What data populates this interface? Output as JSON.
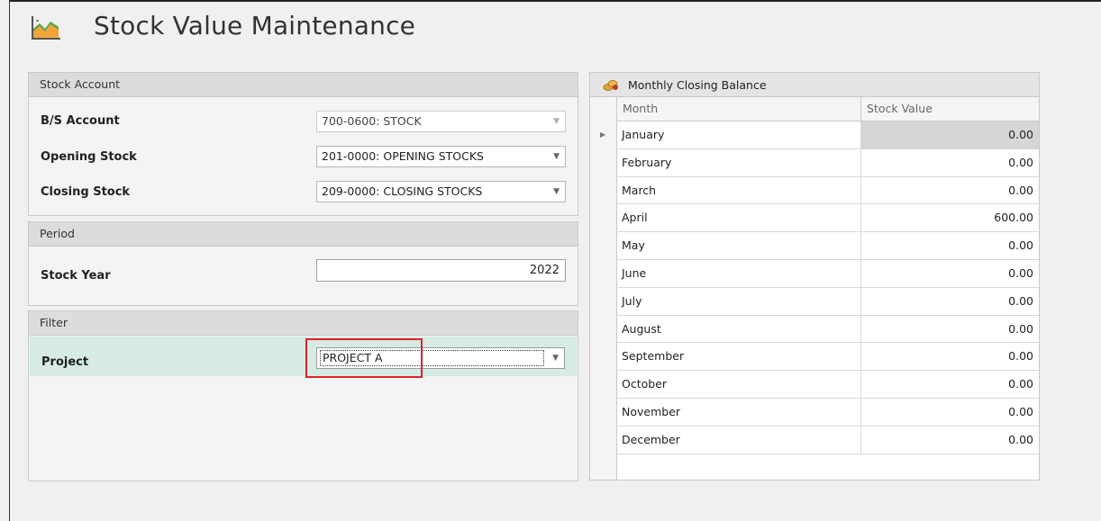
{
  "window": {
    "title": "Stock Value Maintenance"
  },
  "stock_account": {
    "header": "Stock Account",
    "bs_account_label": "B/S Account",
    "bs_account_value": "700-0600: STOCK",
    "opening_stock_label": "Opening Stock",
    "opening_stock_value": "201-0000: OPENING STOCKS",
    "closing_stock_label": "Closing Stock",
    "closing_stock_value": "209-0000: CLOSING STOCKS"
  },
  "period": {
    "header": "Period",
    "stock_year_label": "Stock Year",
    "stock_year_value": "2022"
  },
  "filter": {
    "header": "Filter",
    "project_label": "Project",
    "project_value": "PROJECT A"
  },
  "balance": {
    "header": "Monthly Closing Balance",
    "columns": [
      "Month",
      "Stock Value"
    ],
    "rows": [
      {
        "month": "January",
        "value": "0.00"
      },
      {
        "month": "February",
        "value": "0.00"
      },
      {
        "month": "March",
        "value": "0.00"
      },
      {
        "month": "April",
        "value": "600.00"
      },
      {
        "month": "May",
        "value": "0.00"
      },
      {
        "month": "June",
        "value": "0.00"
      },
      {
        "month": "July",
        "value": "0.00"
      },
      {
        "month": "August",
        "value": "0.00"
      },
      {
        "month": "September",
        "value": "0.00"
      },
      {
        "month": "October",
        "value": "0.00"
      },
      {
        "month": "November",
        "value": "0.00"
      },
      {
        "month": "December",
        "value": "0.00"
      }
    ]
  },
  "icons": {
    "title_icon": "stock-chart-icon",
    "balance_icon": "coins-icon",
    "dropdown": "chevron-down-icon",
    "row_indicator": "row-pointer-icon"
  },
  "colors": {
    "panel_header": "#dcdcdc",
    "focused_row": "#d6ebe3",
    "highlight_box": "#e0222a",
    "selected_cell": "#d6d6d6"
  }
}
